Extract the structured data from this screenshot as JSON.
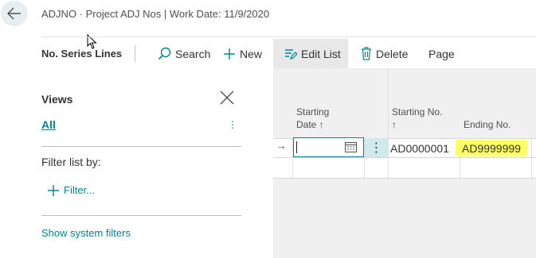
{
  "header": {
    "title": "ADJNO · Project ADJ Nos | Work Date: 11/9/2020"
  },
  "actionbar": {
    "title": "No. Series Lines",
    "search_label": "Search",
    "new_label": "New",
    "edit_list_label": "Edit List",
    "delete_label": "Delete",
    "page_label": "Page"
  },
  "views": {
    "title": "Views",
    "all_label": "All",
    "menu_dots": "⋮",
    "filter_by": "Filter list by:",
    "filter_add": "Filter...",
    "system_filters": "Show system filters"
  },
  "grid": {
    "columns": {
      "starting_date": [
        "Starting",
        "Date ↑"
      ],
      "starting_no": [
        "Starting No.",
        "↑"
      ],
      "ending_no": "Ending No."
    },
    "row_indicator": "→",
    "row_menu": "⋮",
    "rows": [
      {
        "starting_date": "",
        "starting_no": "AD0000001",
        "ending_no": "AD9999999"
      }
    ]
  },
  "colors": {
    "accent": "#00838f",
    "highlight": "#ffff66",
    "selected_cell": "#cfe9ec"
  }
}
